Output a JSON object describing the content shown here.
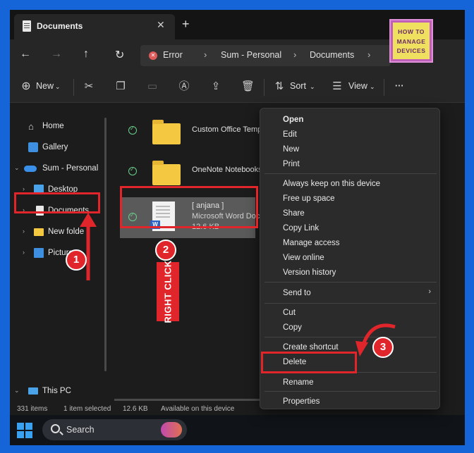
{
  "tab": {
    "title": "Documents",
    "close": "✕",
    "add": "+"
  },
  "nav": {
    "back": "←",
    "forward": "→",
    "up": "↑",
    "refresh": "↻"
  },
  "address": {
    "error": "Error",
    "crumbs": [
      "Sum - Personal",
      "Documents"
    ],
    "sep": "›"
  },
  "logo": {
    "line1": "HOW TO",
    "line2": "MANAGE",
    "line3": "DEVICES"
  },
  "toolbar": {
    "new_label": "New",
    "sort_label": "Sort",
    "view_label": "View",
    "more": "···"
  },
  "sidebar": {
    "items": [
      {
        "label": "Home"
      },
      {
        "label": "Gallery"
      },
      {
        "label": "Sum - Personal"
      },
      {
        "label": "Desktop"
      },
      {
        "label": "Documents"
      },
      {
        "label": "New folde"
      },
      {
        "label": "Pictures"
      },
      {
        "label": "This PC"
      }
    ]
  },
  "files": [
    {
      "name": "Custom Office Templa"
    },
    {
      "name": "OneNote Notebooks"
    },
    {
      "name": "[ anjana ]",
      "type": "Microsoft Word Docu",
      "size": "12.6 KB"
    }
  ],
  "context_menu": {
    "items": [
      "Open",
      "Edit",
      "New",
      "Print",
      "Always keep on this device",
      "Free up space",
      "Share",
      "Copy Link",
      "Manage access",
      "View online",
      "Version history",
      "Send to",
      "Cut",
      "Copy",
      "Create shortcut",
      "Delete",
      "Rename",
      "Properties"
    ]
  },
  "status": {
    "count": "331 items",
    "selected": "1 item selected",
    "size": "12.6 KB",
    "availability": "Available on this device"
  },
  "taskbar": {
    "search_label": "Search"
  },
  "annotations": {
    "step1": "1",
    "step2": "2",
    "step3": "3",
    "right_click": "RIGHT CLICK"
  },
  "colors": {
    "accent_red": "#e0262b",
    "background_blue": "#1565d8",
    "folder": "#f5c842",
    "selection": "#5a5a5a"
  }
}
